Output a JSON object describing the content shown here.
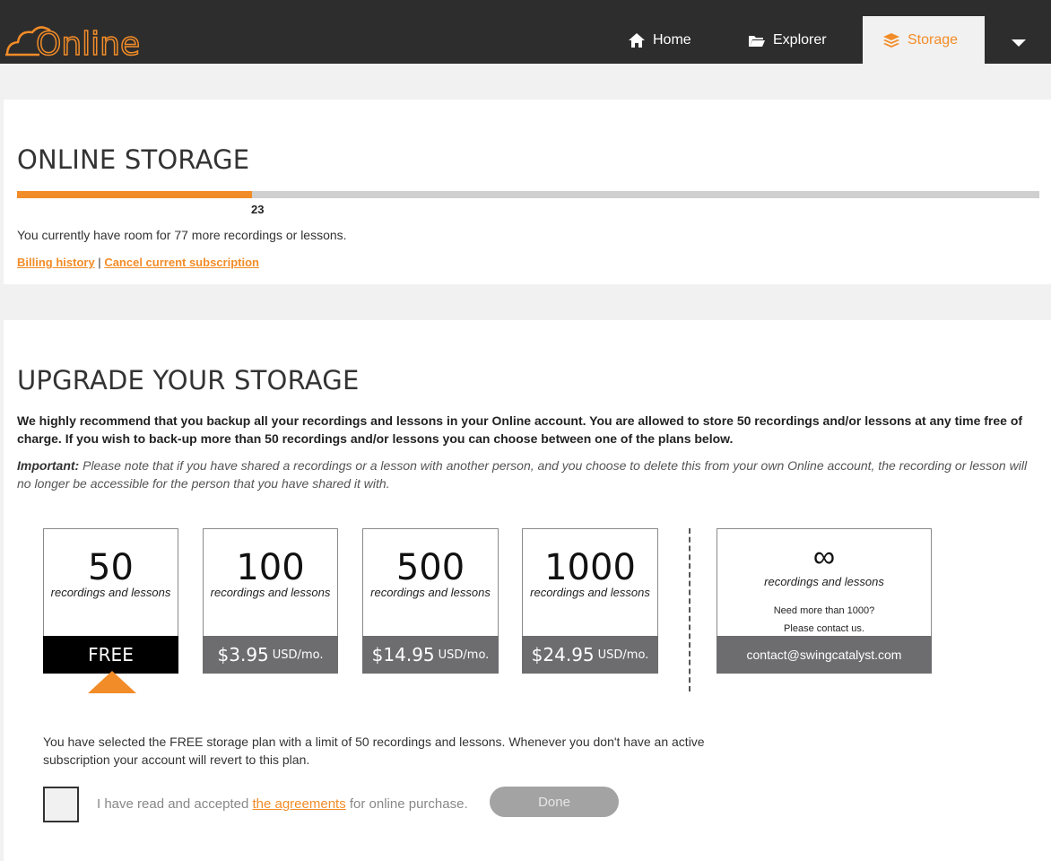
{
  "header": {
    "logo_text": "Online",
    "nav": {
      "home": "Home",
      "explorer": "Explorer",
      "storage": "Storage"
    }
  },
  "storage_panel": {
    "title": "ONLINE STORAGE",
    "used_count": "23",
    "used_fraction": 0.23,
    "room_text": "You currently have room for 77 more recordings or lessons.",
    "billing_link": "Billing history",
    "separator": "|",
    "cancel_link": "Cancel current subscription"
  },
  "upgrade_panel": {
    "title": "UPGRADE YOUR STORAGE",
    "intro": "We highly recommend that you backup all your recordings and lessons in your Online account. You are allowed to store 50 recordings and/or lessons at any time free of charge. If you wish to back-up more than 50 recordings and/or lessons you can choose between one of the plans below.",
    "important_label": "Important:",
    "important_text": " Please note that if you have shared a recordings or a lesson with another person, and you choose to delete this from your own Online account, the recording or lesson will no longer be accessible for the person that you have shared it with.",
    "plans": [
      {
        "count": "50",
        "subtitle": "recordings and lessons",
        "price": "FREE",
        "unit": ""
      },
      {
        "count": "100",
        "subtitle": "recordings and lessons",
        "price": "$3.95",
        "unit": "USD/mo."
      },
      {
        "count": "500",
        "subtitle": "recordings and lessons",
        "price": "$14.95",
        "unit": "USD/mo."
      },
      {
        "count": "1000",
        "subtitle": "recordings and lessons",
        "price": "$24.95",
        "unit": "USD/mo."
      }
    ],
    "unlimited": {
      "symbol": "∞",
      "subtitle": "recordings and lessons",
      "need_line1": "Need more than 1000?",
      "need_line2": "Please contact us.",
      "email": "contact@swingcatalyst.com"
    },
    "selected_text": "You have selected the FREE storage plan with a limit of 50 recordings and lessons. Whenever you don't have an active subscription your account will revert to this plan.",
    "agree_prefix": "I have read and accepted ",
    "agree_link": "the agreements",
    "agree_suffix": " for online purchase.",
    "done_label": "Done"
  },
  "colors": {
    "accent": "#f28c28",
    "topbar": "#2d2d2d",
    "price_bg": "#6d6d6f"
  }
}
